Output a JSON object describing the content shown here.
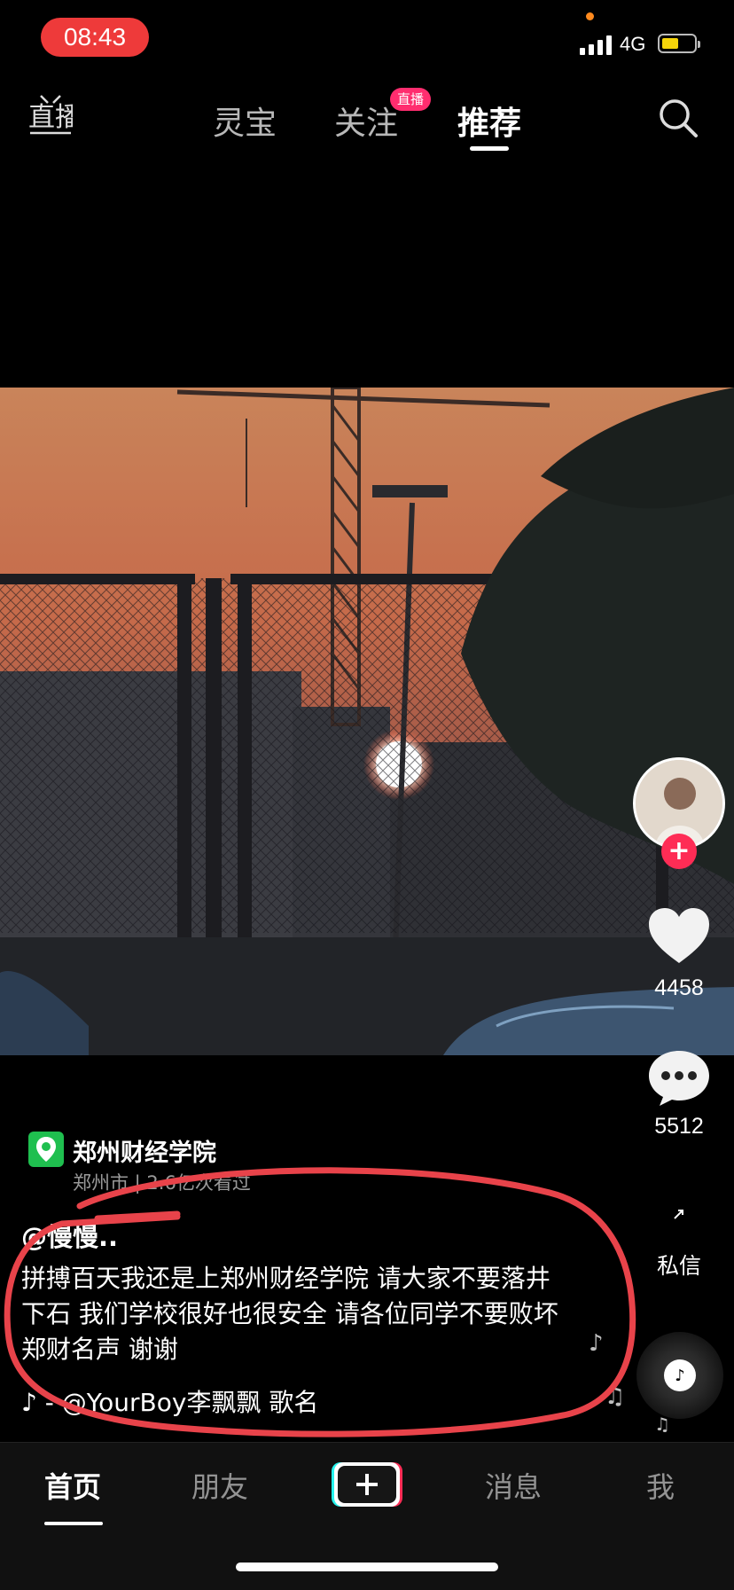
{
  "status_bar": {
    "time": "08:43",
    "network": "4G",
    "battery_level": 0.45
  },
  "top_nav": {
    "live_label": "直播",
    "tabs": [
      {
        "label": "灵宝",
        "active": false
      },
      {
        "label": "关注",
        "active": false,
        "badge": "直播"
      },
      {
        "label": "推荐",
        "active": true
      }
    ]
  },
  "right_rail": {
    "likes": "4458",
    "comments": "5512",
    "dm_label": "私信"
  },
  "location": {
    "name": "郑州财经学院",
    "sub": "郑州市 | 2.6亿次看过"
  },
  "post": {
    "author": "@慢慢..",
    "caption": "拼搏百天我还是上郑州财经学院 请大家不要落井下石  我们学校很好也很安全 请各位同学不要败坏郑财名声 谢谢",
    "music": "♪ - @YourBoy李飘飘    歌名"
  },
  "bottom_nav": [
    {
      "label": "首页",
      "active": true
    },
    {
      "label": "朋友",
      "active": false
    },
    {
      "label": "+",
      "active": false
    },
    {
      "label": "消息",
      "active": false
    },
    {
      "label": "我",
      "active": false
    }
  ],
  "colors": {
    "accent": "#fe2c55",
    "annotation": "#e8434a",
    "location": "#1fbf4f"
  }
}
